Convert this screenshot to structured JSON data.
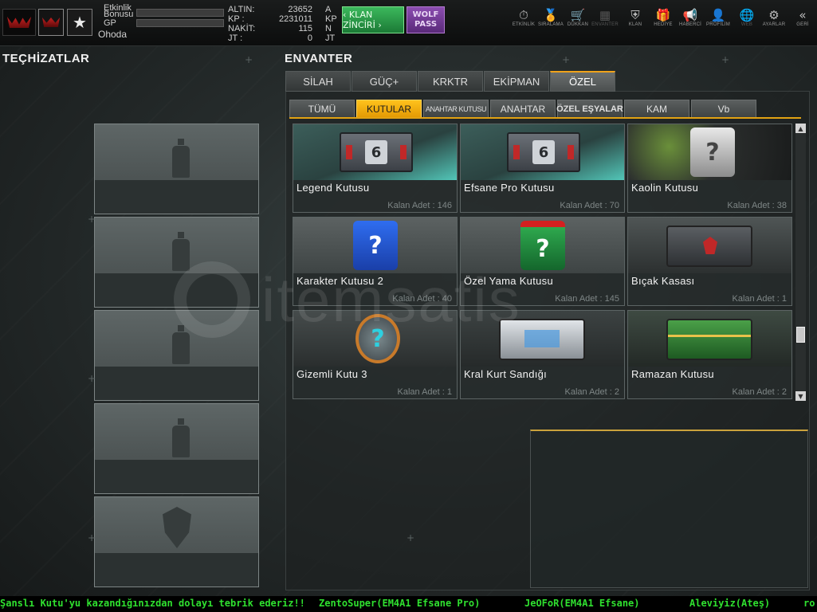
{
  "topbar": {
    "logo_text": "WOLF",
    "rank_glyph": "★",
    "progress": {
      "etkinlik_label": "Etkinlik",
      "bonusu_label": "Bonusu",
      "gp_label": "GP",
      "location": "Ohoda"
    },
    "stats": [
      {
        "key": "ALTIN:",
        "value": "23652",
        "unit": "A"
      },
      {
        "key": "KP   :",
        "value": "2231011",
        "unit": "KP"
      },
      {
        "key": "NAKİT:",
        "value": "115",
        "unit": "N"
      },
      {
        "key": "JT   :",
        "value": "0",
        "unit": "JT"
      }
    ],
    "klan_button": "‹ KLAN ZİNCİRİ ›",
    "wolf_pass": "WOLF PASS",
    "nav": [
      {
        "label": "ETKİNLİK",
        "icon": "stopwatch-icon",
        "glyph": "⏱"
      },
      {
        "label": "SIRALAMA",
        "icon": "medal-icon",
        "glyph": "🏅"
      },
      {
        "label": "DÜKKAN",
        "icon": "cart-icon",
        "glyph": "🛒"
      },
      {
        "label": "ENVANTER",
        "icon": "inventory-icon",
        "glyph": "▦",
        "dim": true
      },
      {
        "label": "KLAN",
        "icon": "shield-icon",
        "glyph": "⛨"
      },
      {
        "label": "HEDİYE",
        "icon": "gift-icon",
        "glyph": "🎁"
      },
      {
        "label": "HABERCİ",
        "icon": "megaphone-icon",
        "glyph": "📢"
      },
      {
        "label": "PROFİLİM",
        "icon": "profile-icon",
        "glyph": "👤"
      },
      {
        "label": "WEB",
        "icon": "globe-icon",
        "glyph": "🌐",
        "dim": true
      },
      {
        "label": "AYARLAR",
        "icon": "gear-icon",
        "glyph": "⚙"
      },
      {
        "label": "GERİ",
        "icon": "back-icon",
        "glyph": "«"
      }
    ]
  },
  "left": {
    "title": "TEÇHİZATLAR"
  },
  "inventory": {
    "title": "ENVANTER",
    "tabs": [
      "SİLAH",
      "GÜÇ+",
      "KRKTR",
      "EKİPMAN",
      "ÖZEL"
    ],
    "active_tab": 4,
    "subtabs": [
      "TÜMÜ",
      "KUTULAR",
      "ANAHTAR KUTUSU",
      "ANAHTAR",
      "ÖZEL EŞYALAR",
      "KAM",
      "Vb"
    ],
    "active_subtab": 1,
    "items": [
      {
        "name": "Legend Kutusu",
        "count": "Kalan Adet : 146"
      },
      {
        "name": "Efsane Pro Kutusu",
        "count": "Kalan Adet : 70"
      },
      {
        "name": "Kaolin Kutusu",
        "count": "Kalan Adet : 38"
      },
      {
        "name": "Karakter Kutusu 2",
        "count": "Kalan Adet : 40"
      },
      {
        "name": "Özel Yama Kutusu",
        "count": "Kalan Adet : 145"
      },
      {
        "name": "Bıçak Kasası",
        "count": "Kalan Adet : 1"
      },
      {
        "name": "Gizemli Kutu 3",
        "count": "Kalan Adet : 1"
      },
      {
        "name": "Kral Kurt Sandığı",
        "count": "Kalan Adet : 2"
      },
      {
        "name": "Ramazan Kutusu",
        "count": "Kalan Adet : 2"
      }
    ],
    "box_badge": "6",
    "mystery_glyph": "?"
  },
  "watermark": "itemsatis",
  "ticker": [
    "Şanslı Kutu'yu kazandığınızdan dolayı tebrik ederiz!!",
    "ZentoSuper(EM4A1 Efsane Pro)",
    "JeOFoR(EM4A1 Efsane)",
    "Aleviyiz(Ateş)",
    "ro"
  ]
}
